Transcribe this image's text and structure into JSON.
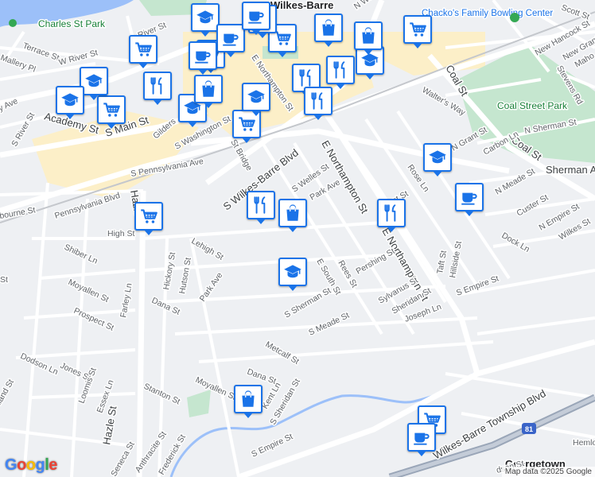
{
  "map": {
    "attribution": "Map data ©2025 Google",
    "logo": "Google",
    "colors": {
      "water": "#9cc0f9",
      "park": "#c5e6cf",
      "commercial": "#fcefc8",
      "road": "#ffffff",
      "highway": "#9aa6b8",
      "background": "#eef0f3",
      "pin_border": "#1a73e8"
    },
    "labels": {
      "charles_st_park": "Charles St Park",
      "wilkes_barre": "Wilkes-Barre",
      "chackos": "Chacko's Family Bowling Center",
      "coal_street_park": "Coal Street Park",
      "sherman_apartments": "Sherman Apartments",
      "georgetown": "Georgetown",
      "terrace_st": "Terrace St",
      "w_river_st": "W River St",
      "river_st": "River St",
      "mallery_pl": "Mallery Pl",
      "academy_st": "Academy St",
      "s_river_st": "S River St",
      "s_franklin": "S Fr",
      "s_main_st": "S Main St",
      "gildersleeve": "Gilders",
      "s_washington_st": "S Washington St",
      "s_pennsylvania_ave": "S Pennsylvania Ave",
      "pennsylvania_blvd": "Pennsylvania Blvd",
      "hazle_st": "Hazle St",
      "hazle_st_2": "Hazle St",
      "borne_st": "bourne St",
      "s_wilkes_barre_blvd": "S Wilkes-Barre Blvd",
      "st_bridge": "St Bridge",
      "e_northampton_st": "E Northampton St",
      "e_northampton_st_2": "E Northampton St",
      "e_northampton_st_top": "E Northampton St",
      "s_welles_st": "S Welles St",
      "park_ave": "Park Ave",
      "park_ave_2": "Park Ave",
      "walters_way": "Walter's Way",
      "coal_st": "Coal St",
      "coal_st_2": "Coal St",
      "n_grant_st": "N Grant St",
      "carbon_ln": "Carbon Ln",
      "n_sherman_st": "N Sherman St",
      "n_meade_st": "N Meade St",
      "custer_st": "Custer St",
      "n_empire_st": "N Empire St",
      "wilkes_st": "Wilkes St",
      "dock_ln": "Dock Ln",
      "rose_ln": "Rose Ln",
      "grant_st": "Grant St",
      "pershing_st": "Pershing St",
      "sylvanus_st": "Sylvanus St",
      "sheridan_st": "Sheridan St",
      "taft_st": "Taft St",
      "hillside_st": "Hillside St",
      "s_empire_st": "S Empire St",
      "joseph_ln": "Joseph Ln",
      "rees_st": "Rees St",
      "e_south_st": "E South St",
      "s_sherman_st": "S Sherman St",
      "s_meade_st": "S Meade St",
      "metcalf_st": "Metcalf St",
      "dana_st": "Dana St",
      "dana_st_2": "Dana St",
      "kent_ln": "Kent Ln",
      "s_sheridan_st": "S Sheridan St",
      "s_empire_st_2": "S Empire St",
      "wilkes_barre_township_blvd": "Wilkes-Barre Township Blvd",
      "high_st": "High St",
      "shiber_ln": "Shiber Ln",
      "lehigh_st": "Lehigh St",
      "hickory_st": "Hickory St",
      "hutson_st": "Hutson St",
      "moyallen_st": "Moyallen St",
      "moyallen_st_2": "Moyallen St",
      "prospect_st": "Prospect St",
      "farley_ln": "Farley Ln",
      "dodson_ln": "Dodson Ln",
      "jones_st": "Jones St",
      "loomis_st": "Loomis St",
      "essex_ln": "Essex Ln",
      "stanton_st": "Stanton St",
      "holland_st": "lland St",
      "seneca_st": "Seneca St",
      "anthracite_st": "Anthracite St",
      "frederick_st": "Frederick St",
      "n_wash": "N Wash",
      "scott_st": "Scott St",
      "new_hancock_st": "New Hancock St",
      "new_grant": "New Grant",
      "mahoning": "Maho",
      "stevens_rd": "Stevens Rd",
      "hemlock": "Hemlo",
      "hudson_st": "dson St",
      "ave_left": "y Ave",
      "st_left": "St",
      "route_81": "81"
    },
    "pins": [
      {
        "icon": "cart"
      },
      {
        "icon": "cart"
      },
      {
        "icon": "cart"
      },
      {
        "icon": "cart"
      },
      {
        "icon": "cart"
      },
      {
        "icon": "cart"
      },
      {
        "icon": "cart"
      },
      {
        "icon": "cart"
      },
      {
        "icon": "school"
      },
      {
        "icon": "school"
      },
      {
        "icon": "school"
      },
      {
        "icon": "school"
      },
      {
        "icon": "school"
      },
      {
        "icon": "school"
      },
      {
        "icon": "school"
      },
      {
        "icon": "school"
      },
      {
        "icon": "restaurant"
      },
      {
        "icon": "restaurant"
      },
      {
        "icon": "restaurant"
      },
      {
        "icon": "restaurant"
      },
      {
        "icon": "restaurant"
      },
      {
        "icon": "restaurant"
      },
      {
        "icon": "restaurant"
      },
      {
        "icon": "cafe"
      },
      {
        "icon": "cafe"
      },
      {
        "icon": "cafe"
      },
      {
        "icon": "cafe"
      },
      {
        "icon": "cafe"
      },
      {
        "icon": "shopping-bag"
      },
      {
        "icon": "shopping-bag"
      },
      {
        "icon": "shopping-bag"
      },
      {
        "icon": "shopping-bag"
      },
      {
        "icon": "shopping-bag"
      }
    ]
  }
}
